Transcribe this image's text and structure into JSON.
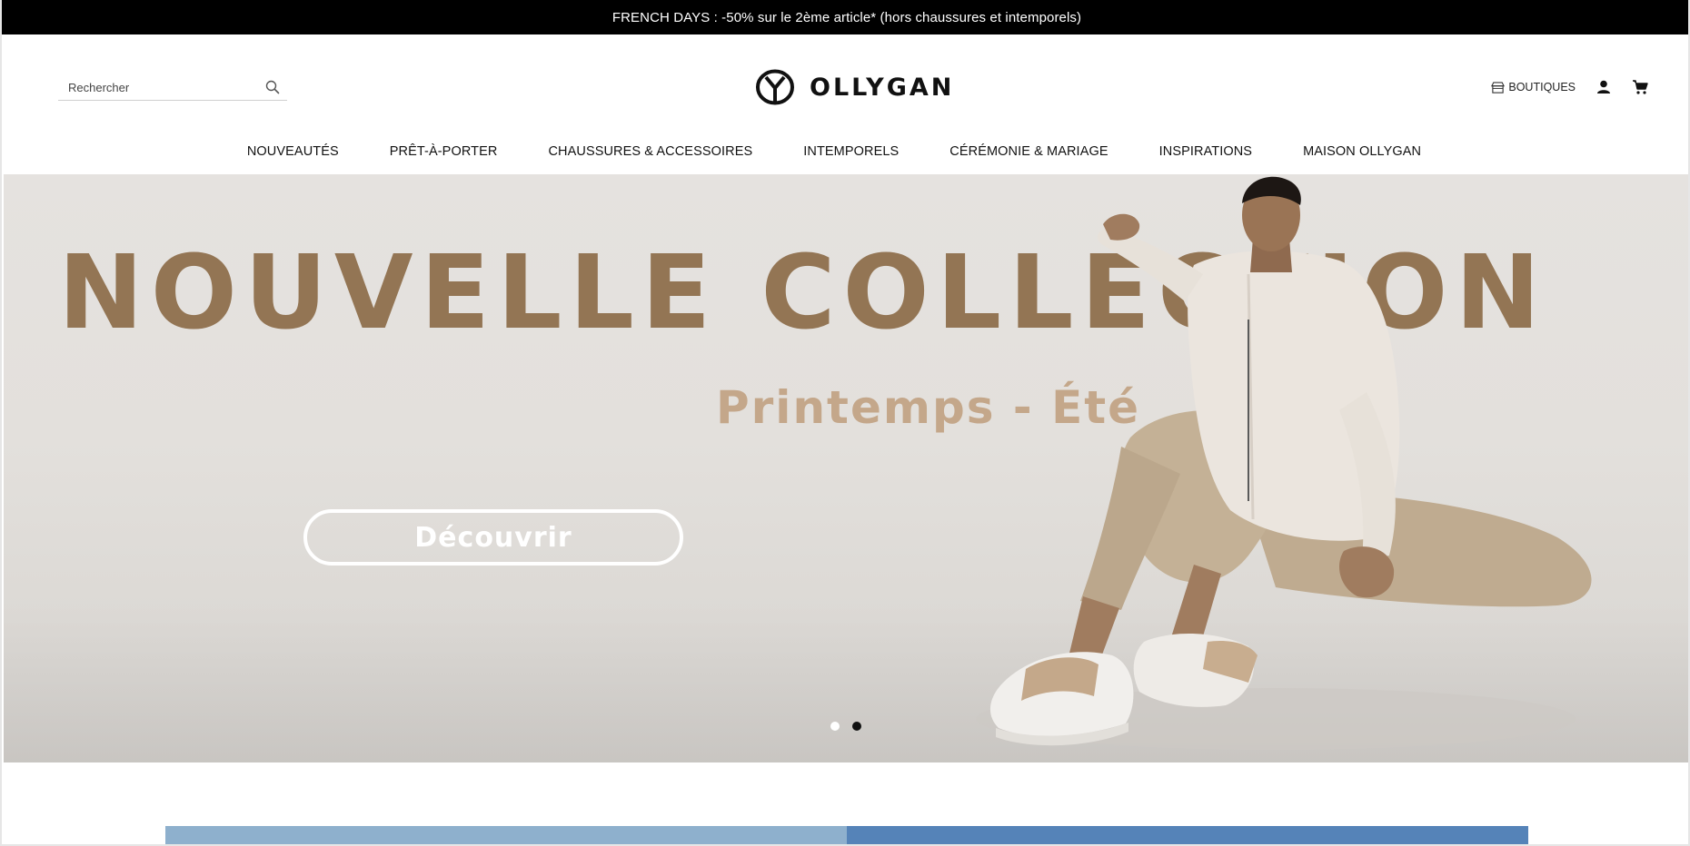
{
  "promo": {
    "text": "FRENCH DAYS : -50% sur le 2ème article* (hors chaussures et intemporels)"
  },
  "header": {
    "search": {
      "placeholder": "Rechercher",
      "value": ""
    },
    "logo_text": "OLLYGAN",
    "boutiques_label": "BOUTIQUES"
  },
  "nav": {
    "items": [
      {
        "label": "NOUVEAUTÉS"
      },
      {
        "label": "PRÊT-À-PORTER"
      },
      {
        "label": "CHAUSSURES & ACCESSOIRES"
      },
      {
        "label": "INTEMPORELS"
      },
      {
        "label": "CÉRÉMONIE & MARIAGE"
      },
      {
        "label": "INSPIRATIONS"
      },
      {
        "label": "MAISON OLLYGAN"
      }
    ]
  },
  "hero": {
    "title": "NOUVELLE COLLECTION",
    "subtitle": "Printemps - Été",
    "cta_label": "Découvrir",
    "slides": [
      {
        "active": false
      },
      {
        "active": true
      }
    ]
  },
  "icons": {
    "search": "search-icon",
    "boutiques": "store-icon",
    "account": "user-icon",
    "cart": "cart-icon",
    "logo": "ollygan-logo-mark"
  },
  "colors": {
    "promo_bg": "#000000",
    "title": "#937554",
    "subtitle": "#c4a78a",
    "hero_bg": "#e3e0dc",
    "dot_active": "#111111",
    "dot_inactive": "#ffffff"
  }
}
